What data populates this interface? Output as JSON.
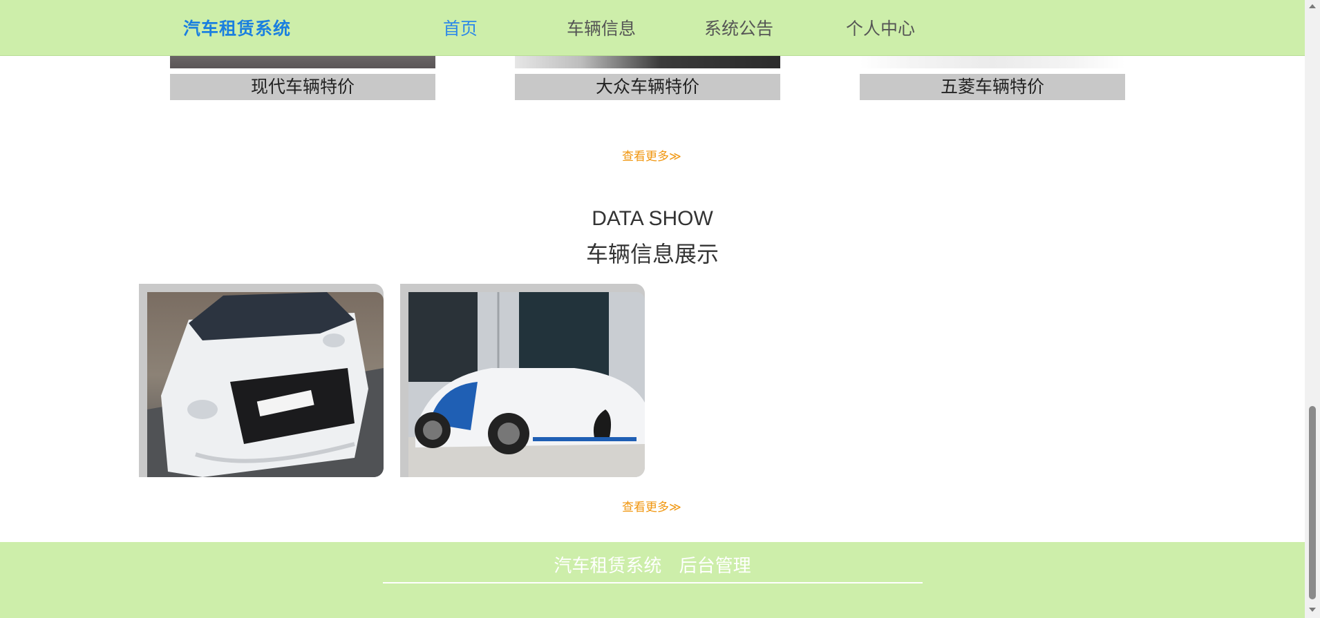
{
  "nav": {
    "brand": "汽车租赁系统",
    "items": [
      "首页",
      "车辆信息",
      "系统公告",
      "个人中心"
    ],
    "active_index": 0
  },
  "promos": [
    {
      "label": "现代车辆特价"
    },
    {
      "label": "大众车辆特价"
    },
    {
      "label": "五菱车辆特价"
    }
  ],
  "more_link_1": "查看更多≫",
  "section": {
    "title_en": "DATA SHOW",
    "title_cn": "车辆信息展示"
  },
  "more_link_2": "查看更多≫",
  "footer": {
    "links": [
      "汽车租赁系统",
      "后台管理"
    ]
  },
  "colors": {
    "nav_bg": "#cdeeaa",
    "brand": "#1a7fe0",
    "more_link": "#f0960f"
  }
}
